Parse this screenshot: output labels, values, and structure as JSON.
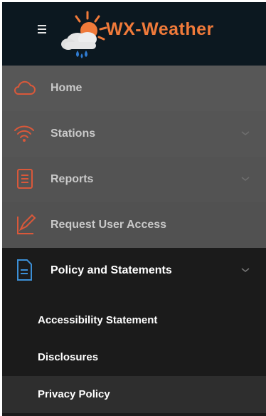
{
  "header": {
    "brand": "WX-Weather",
    "menu_icon": "hamburger-icon",
    "logo_icon": "sun-cloud-rain-logo"
  },
  "nav": {
    "items": [
      {
        "label": "Home",
        "icon": "cloud-icon"
      },
      {
        "label": "Stations",
        "icon": "wifi-icon",
        "expandable": true
      },
      {
        "label": "Reports",
        "icon": "report-icon",
        "expandable": true
      },
      {
        "label": "Request User Access",
        "icon": "edit-access-icon"
      },
      {
        "label": "Policy and Statements",
        "icon": "document-icon",
        "expandable": true,
        "expanded": true
      }
    ],
    "submenu": [
      {
        "label": "Accessibility Statement"
      },
      {
        "label": "Disclosures"
      },
      {
        "label": "Privacy Policy",
        "active": true
      }
    ]
  },
  "colors": {
    "accent": "#f07a3a",
    "header_bg": "#0c1820",
    "nav_bg": "#555555",
    "active_bg": "#1b1b1b",
    "policy_icon": "#3c8fd6"
  }
}
